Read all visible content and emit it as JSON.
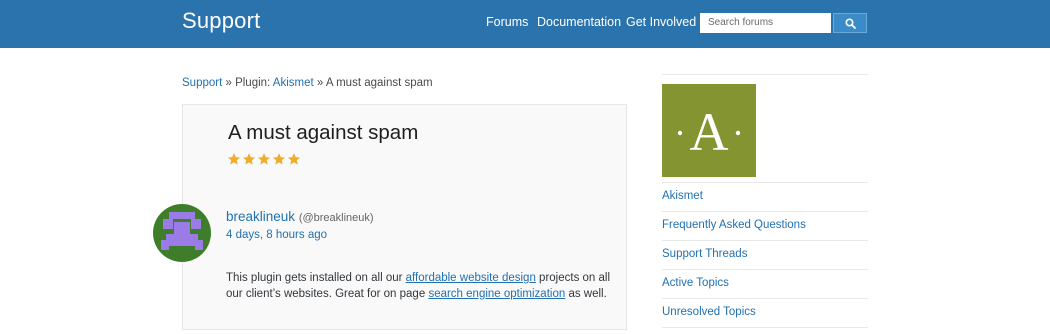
{
  "header": {
    "site_title": "Support",
    "nav": [
      "Forums",
      "Documentation",
      "Get Involved"
    ],
    "search_placeholder": "Search forums",
    "search_icon": "search-icon",
    "bg_color": "#2b73ac"
  },
  "breadcrumb": {
    "root": "Support",
    "sep1": " » Plugin: ",
    "plugin": "Akismet",
    "sep2": " » ",
    "current": "A must against spam"
  },
  "topic": {
    "title": "A must against spam",
    "rating": 5,
    "rating_max": 5,
    "author_name": "breaklineuk",
    "author_handle": "(@breaklineuk)",
    "date": "4 days, 8 hours ago",
    "body": {
      "t1": "This plugin gets installed on all our ",
      "link1": "affordable website design",
      "t2": " projects on all our client’s websites. Great for on page ",
      "link2": "search engine optimization",
      "t3": " as well."
    }
  },
  "sidebar": {
    "icon_letter": "A",
    "icon_color": "#849431",
    "links": [
      "Akismet",
      "Frequently Asked Questions",
      "Support Threads",
      "Active Topics",
      "Unresolved Topics"
    ]
  }
}
